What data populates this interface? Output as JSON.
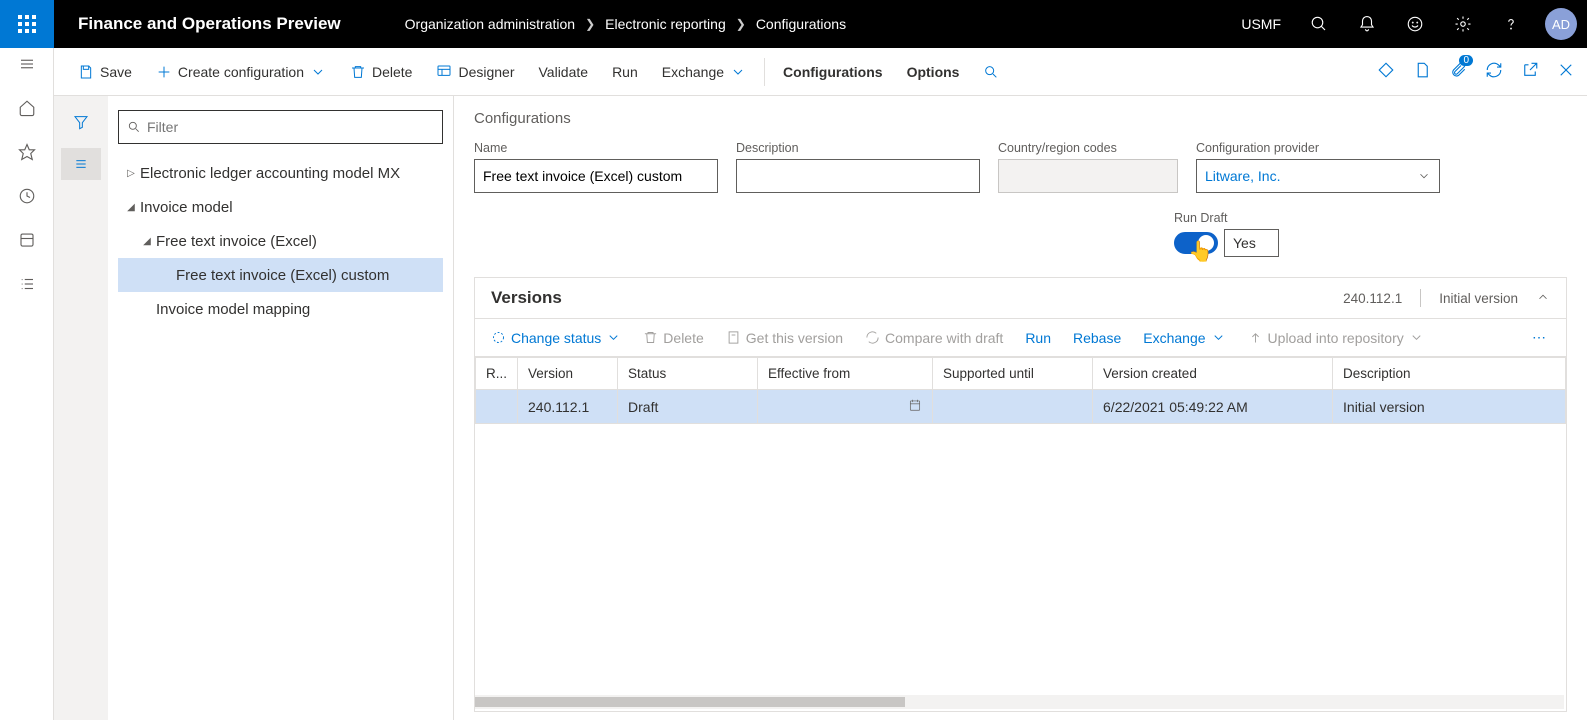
{
  "topbar": {
    "app_title": "Finance and Operations Preview",
    "breadcrumb": [
      "Organization administration",
      "Electronic reporting",
      "Configurations"
    ],
    "company": "USMF",
    "avatar": "AD",
    "notification_badge": "0"
  },
  "cmdbar": {
    "save": "Save",
    "create": "Create configuration",
    "delete": "Delete",
    "designer": "Designer",
    "validate": "Validate",
    "run": "Run",
    "exchange": "Exchange",
    "configurations": "Configurations",
    "options": "Options"
  },
  "tree": {
    "filter_placeholder": "Filter",
    "nodes": {
      "n0": "Electronic ledger accounting model MX",
      "n1": "Invoice model",
      "n2": "Free text invoice (Excel)",
      "n3": "Free text invoice (Excel) custom",
      "n4": "Invoice model mapping"
    }
  },
  "form": {
    "section": "Configurations",
    "labels": {
      "name": "Name",
      "description": "Description",
      "country": "Country/region codes",
      "provider": "Configuration provider",
      "rundraft": "Run Draft"
    },
    "values": {
      "name": "Free text invoice (Excel) custom",
      "description": "",
      "country": "",
      "provider": "Litware, Inc.",
      "rundraft": "Yes"
    }
  },
  "versions": {
    "title": "Versions",
    "summary_version": "240.112.1",
    "summary_desc": "Initial version",
    "toolbar": {
      "change_status": "Change status",
      "delete": "Delete",
      "get": "Get this version",
      "compare": "Compare with draft",
      "run": "Run",
      "rebase": "Rebase",
      "exchange": "Exchange",
      "upload": "Upload into repository"
    },
    "columns": {
      "r": "R...",
      "version": "Version",
      "status": "Status",
      "effective": "Effective from",
      "supported": "Supported until",
      "created": "Version created",
      "desc": "Description"
    },
    "rows": [
      {
        "r": "",
        "version": "240.112.1",
        "status": "Draft",
        "effective": "",
        "supported": "",
        "created": "6/22/2021 05:49:22 AM",
        "desc": "Initial version"
      }
    ]
  }
}
